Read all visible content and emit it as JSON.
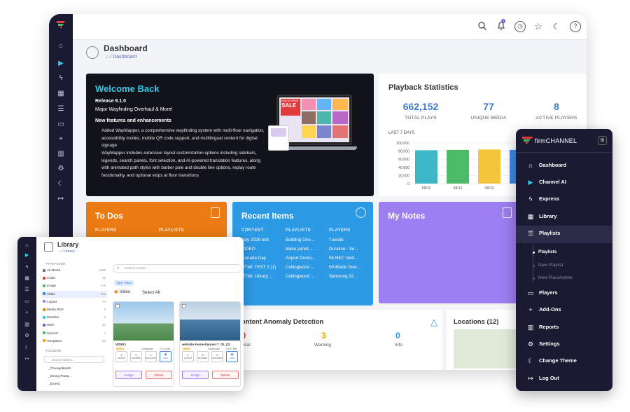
{
  "dashboard": {
    "title": "Dashboard",
    "breadcrumb": "Dashboard",
    "welcome": {
      "title": "Welcome Back",
      "release": "Release 9.1.0",
      "subtitle": "Major Wayfinding Overhaul & More!",
      "features_heading": "New features and enhancements",
      "para1": "Added WayMapper, a comprehensive wayfinding system with multi-floor navigation, accessibility modes, mobile QR code support, and multilingual content for digital signage",
      "para2": "WayMapper includes extensive layout customization options including sidebars, legends, search panels, font selection, and AI-powered translation features, along with animated path styles with barber pole and double line options, replay route functionality, and optional stops at floor transitions",
      "screen_text": [
        "END OF WEEK",
        "SALE"
      ]
    },
    "playback": {
      "title": "Playback Statistics",
      "stats": [
        {
          "value": "662,152",
          "label": "TOTAL PLAYS"
        },
        {
          "value": "77",
          "label": "UNIQUE MEDIA"
        },
        {
          "value": "8",
          "label": "ACTIVE PLAYERS"
        }
      ],
      "period_label": "LAST 7 DAYS"
    },
    "todos": {
      "title": "To Dos",
      "col1": "PLAYERS",
      "col2": "PLAYLISTS"
    },
    "recent": {
      "title": "Recent Items",
      "headers": [
        "CONTENT",
        "PLAYLISTS",
        "PLAYERS"
      ],
      "rows": [
        [
          "July 2026 test",
          "Building Dire...",
          "Tuxedo"
        ],
        [
          "VIDEO",
          "blake jarrett -...",
          "Duraline - Ve..."
        ],
        [
          "Canada Day",
          "Airport Demo...",
          "55 NEC Verti..."
        ],
        [
          "HTML TEST 2 (1)",
          "Collingwood ...",
          "50-Black-Touc..."
        ],
        [
          "HTML Library ...",
          "Collingwood ...",
          "Samsung 32 ..."
        ]
      ]
    },
    "notes": {
      "title": "My Notes"
    },
    "anomaly": {
      "title": "Content Anomaly Detection",
      "items": [
        {
          "value": "40",
          "label": "Critical",
          "color": "#e53935"
        },
        {
          "value": "3",
          "label": "Warning",
          "color": "#f0a500"
        },
        {
          "value": "0",
          "label": "Info",
          "color": "#2d9ae6"
        }
      ]
    },
    "locations": {
      "title": "Locations (12)"
    },
    "topbar_icons": [
      "search-icon",
      "bell-icon",
      "clock-icon",
      "star-icon",
      "moon-icon",
      "help-icon"
    ],
    "notification_count": "0"
  },
  "chart_data": {
    "type": "bar",
    "categories": [
      "08/11",
      "08/12",
      "08/13",
      "08/14"
    ],
    "values": [
      82000,
      83000,
      84000,
      83000
    ],
    "ylim": [
      0,
      100000
    ],
    "yticks": [
      "100,000",
      "80,000",
      "60,000",
      "40,000",
      "20,000",
      "0"
    ],
    "colors": [
      "#3fb6c8",
      "#4cba66",
      "#f5c63b",
      "#3f86e0"
    ],
    "grid": true
  },
  "library": {
    "title": "Library",
    "breadcrumb": "Library",
    "type_filter_label": "TYPE FILTER",
    "types": [
      {
        "label": "All Media",
        "count": "1058"
      },
      {
        "label": "Audio",
        "count": "12"
      },
      {
        "label": "Image",
        "count": "278"
      },
      {
        "label": "Video",
        "count": "302"
      },
      {
        "label": "Layout",
        "count": "74"
      },
      {
        "label": "Media RSS",
        "count": "8"
      },
      {
        "label": "Weather",
        "count": "8"
      },
      {
        "label": "Web",
        "count": "32"
      },
      {
        "label": "Synced",
        "count": "4"
      },
      {
        "label": "Templates",
        "count": "20"
      }
    ],
    "folders_label": "FOLDERS",
    "folder_search_placeholder": "Search folders...",
    "folders": [
      "_ChicagoBooth",
      "_Dining Pianp...",
      "_Ernest"
    ],
    "search_placeholder": "Search media...",
    "filter_chip": "Type: Video",
    "video_tab": "Video",
    "select_all": "Select All",
    "cards": [
      {
        "name": "VIDEO",
        "badge": "VIDEO",
        "res": "Landscape",
        "size": "76.76 MB",
        "btns": [
          "1",
          "0",
          "1"
        ],
        "btn_labels": [
          "LAYOUT",
          "PLAYERS",
          "PLAYLISTS"
        ],
        "view": "VIEW",
        "assign": "Assign",
        "delete": "Delete"
      },
      {
        "name": "website-home-banner-7_02_(1)",
        "badge": "VIDEO",
        "res": "Landscape",
        "size": "14.67 MB",
        "btns": [
          "1",
          "0",
          "0"
        ],
        "btn_labels": [
          "LAYOUT",
          "PLAYERS",
          "PLAYLISTS"
        ],
        "view": "VIEW",
        "assign": "Assign",
        "delete": "Delete"
      }
    ]
  },
  "menu": {
    "brand": "firmCHANNEL",
    "items": [
      {
        "label": "Dashboard",
        "icon": "home-icon"
      },
      {
        "label": "Channel AI",
        "icon": "play-icon"
      },
      {
        "label": "Express",
        "icon": "bolt-icon"
      },
      {
        "label": "Library",
        "icon": "film-icon"
      },
      {
        "label": "Playlists",
        "icon": "list-icon"
      },
      {
        "label": "Players",
        "icon": "tv-icon"
      },
      {
        "label": "Add-Ons",
        "icon": "plus-icon"
      },
      {
        "label": "Reports",
        "icon": "chart-icon"
      },
      {
        "label": "Settings",
        "icon": "gear-icon"
      },
      {
        "label": "Change Theme",
        "icon": "moon-icon"
      },
      {
        "label": "Log Out",
        "icon": "logout-icon"
      }
    ],
    "sub": [
      "Playlists",
      "New Playlist",
      "New Placeholder"
    ]
  }
}
